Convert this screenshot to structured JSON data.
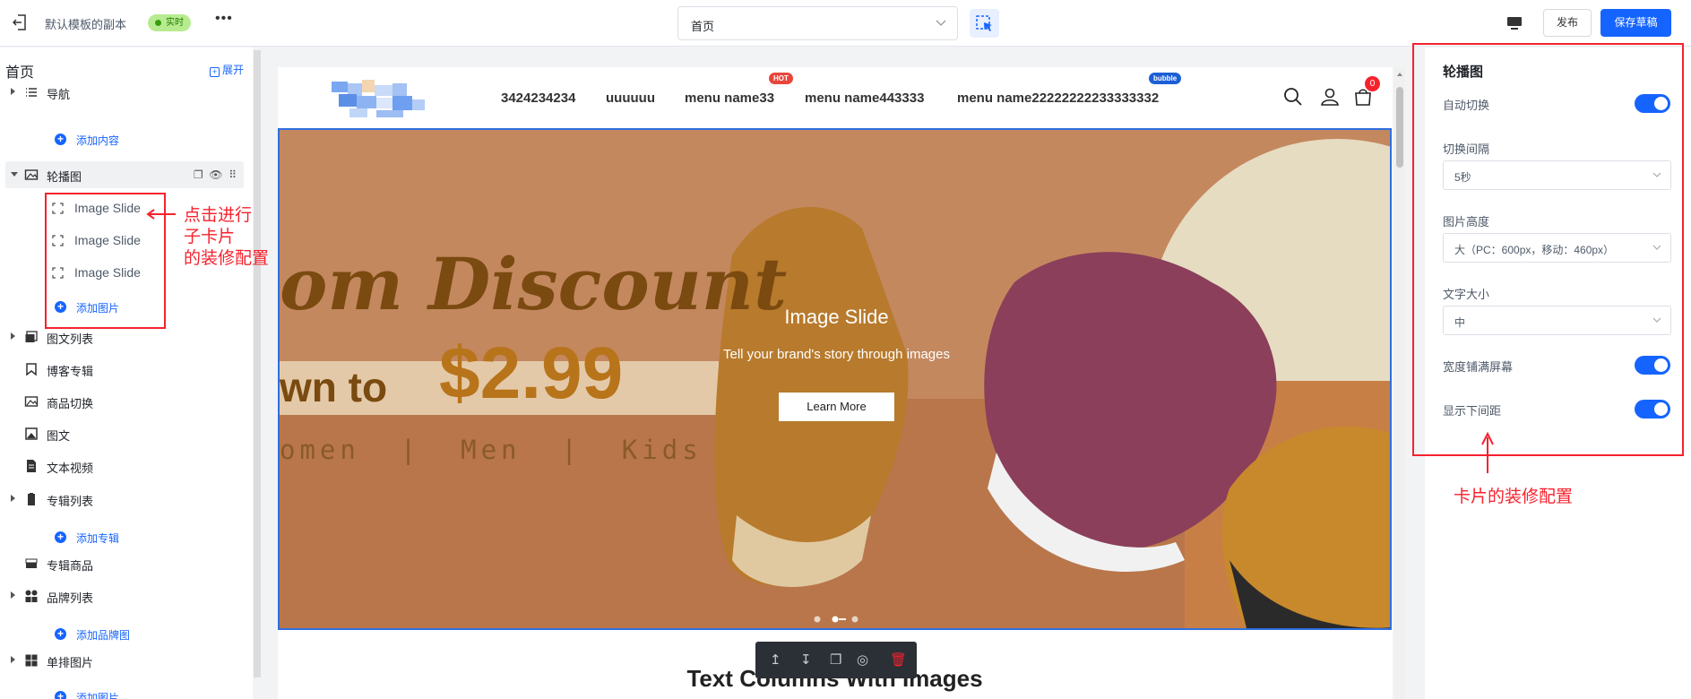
{
  "topbar": {
    "title": "默认模板的副本",
    "status_badge": "实时",
    "more": "•••",
    "page_select_value": "首页",
    "publish_label": "发布",
    "save_label": "保存草稿"
  },
  "sidebar": {
    "heading": "首页",
    "expand_label": "展开",
    "items": {
      "nav": "导航",
      "add_content": "添加内容",
      "carousel": "轮播图",
      "slides": [
        "Image Slide",
        "Image Slide",
        "Image Slide"
      ],
      "add_image": "添加图片",
      "image_text_list": "图文列表",
      "blog_collection": "博客专辑",
      "product_switch": "商品切换",
      "image_text": "图文",
      "text_video": "文本视频",
      "collection_list": "专辑列表",
      "add_collection": "添加专辑",
      "collection_products": "专辑商品",
      "brand_list": "品牌列表",
      "add_brand": "添加品牌图",
      "single_row_images": "单排图片",
      "add_image_2": "添加图片"
    }
  },
  "annotations": {
    "left_lines": [
      "点击进行",
      "子卡片",
      "的装修配置"
    ],
    "right_text": "卡片的装修配置"
  },
  "store": {
    "nav_links": [
      "3424234234",
      "uuuuuu",
      "menu name33",
      "menu name443333",
      "menu name22222222233333332"
    ],
    "badge_hot": "HOT",
    "badge_bubble": "bubble",
    "cart_count": "0",
    "slide_title": "Image Slide",
    "slide_subtitle": "Tell your brand's story through images",
    "slide_button": "Learn More",
    "promo_line1": "om Discount",
    "promo_line2_a": "wn to",
    "promo_line2_b": "$2.99",
    "promo_line3": "omen  |  Men  |  Kids",
    "next_section_title": "Text Columns With Images"
  },
  "panel": {
    "title": "轮播图",
    "auto_switch": "自动切换",
    "interval_label": "切换间隔",
    "interval_value": "5秒",
    "image_height_label": "图片高度",
    "image_height_value": "大（PC：600px，移动：460px）",
    "font_size_label": "文字大小",
    "font_size_value": "中",
    "full_width": "宽度铺满屏幕",
    "bottom_spacing": "显示下间距"
  },
  "colors": {
    "primary": "#1664ff",
    "annotation_red": "#f5222d",
    "live_badge": "#b7eb8f"
  }
}
